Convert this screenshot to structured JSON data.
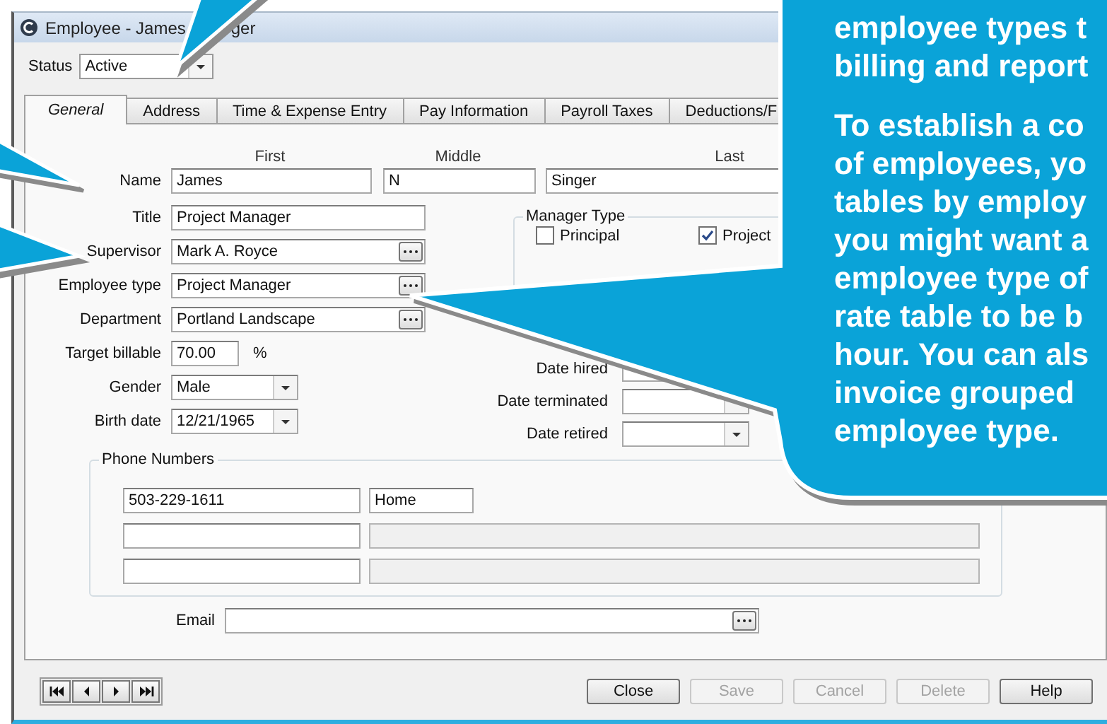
{
  "window": {
    "title_fragments": [
      "Employee - James",
      "ger"
    ]
  },
  "status": {
    "label": "Status",
    "value": "Active"
  },
  "tabs": [
    {
      "label": "General",
      "selected": true
    },
    {
      "label": "Address",
      "selected": false
    },
    {
      "label": "Time & Expense Entry",
      "selected": false
    },
    {
      "label": "Pay Information",
      "selected": false
    },
    {
      "label": "Payroll Taxes",
      "selected": false
    },
    {
      "label": "Deductions/F",
      "selected": false
    }
  ],
  "name_headers": [
    "First",
    "Middle",
    "Last"
  ],
  "name": {
    "label": "Name",
    "first": "James",
    "middle": "N",
    "last": "Singer"
  },
  "fields": [
    {
      "label": "Title",
      "value": "Project Manager",
      "kind": "text"
    },
    {
      "label": "Supervisor",
      "value": "Mark A. Royce",
      "kind": "lookup"
    },
    {
      "label": "Employee type",
      "value": "Project Manager",
      "kind": "lookup"
    },
    {
      "label": "Department",
      "value": "Portland Landscape",
      "kind": "lookup"
    },
    {
      "label": "Target billable",
      "value": "70.00",
      "kind": "percent",
      "suffix": "%"
    },
    {
      "label": "Gender",
      "value": "Male",
      "kind": "dropdown"
    },
    {
      "label": "Birth date",
      "value": "12/21/1965",
      "kind": "dropdown"
    }
  ],
  "manager_type": {
    "title": "Manager Type",
    "options": [
      {
        "label": "Principal",
        "checked": false
      },
      {
        "label": "Project",
        "checked": true
      }
    ]
  },
  "dates": [
    {
      "label": "Date hired"
    },
    {
      "label": "Date terminated"
    },
    {
      "label": "Date retired"
    }
  ],
  "phone_numbers": {
    "title": "Phone Numbers",
    "rows": [
      {
        "number": "503-229-1611",
        "type": "Home",
        "disabled": false
      },
      {
        "disabled": true
      },
      {
        "disabled": true
      }
    ]
  },
  "email": {
    "label": "Email"
  },
  "buttons": [
    {
      "label": "Close",
      "disabled": false
    },
    {
      "label": "Save",
      "disabled": true
    },
    {
      "label": "Cancel",
      "disabled": true
    },
    {
      "label": "Delete",
      "disabled": true
    },
    {
      "label": "Help",
      "disabled": false
    }
  ],
  "callout": {
    "paragraphs": [
      [
        "employee types t",
        "billing and report"
      ],
      [
        "To establish a co",
        "of employees, yo",
        "tables by employ",
        "you might want a",
        "employee type of",
        "rate table to be b",
        "hour. You can als",
        "invoice grouped",
        "employee type."
      ]
    ]
  }
}
